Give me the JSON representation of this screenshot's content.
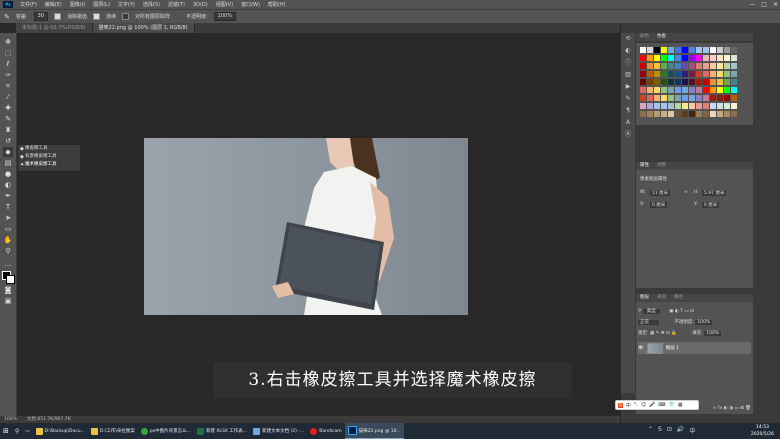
{
  "menu": {
    "app_logo": "Ps",
    "items": [
      "文件(F)",
      "编辑(E)",
      "图像(I)",
      "图层(L)",
      "文字(Y)",
      "选择(S)",
      "滤镜(T)",
      "3D(D)",
      "视图(V)",
      "窗口(W)",
      "帮助(H)"
    ],
    "min": "—",
    "max": "□",
    "close": "✕"
  },
  "options": {
    "tolerance_label": "容差:",
    "tolerance_value": "30",
    "antialias_label": "消除锯齿",
    "contiguous_label": "连续",
    "all_layers_label": "对所有图层取样",
    "opacity_label": "不透明度:",
    "opacity_value": "100%"
  },
  "tabs": [
    "未标题-1 @ 66.7%(RGB/8)",
    "猫咪22.png @ 100% (图层 1, RGB/8)"
  ],
  "flyout": {
    "items": [
      "橡皮擦工具",
      "背景橡皮擦工具",
      "魔术橡皮擦工具"
    ],
    "shortcut": "E"
  },
  "caption": "3.右击橡皮擦工具并选择魔术橡皮擦",
  "status": {
    "zoom": "100%",
    "doc": "文档:851.7K/907.7K"
  },
  "panels": {
    "color_tabs": [
      "颜色",
      "色板"
    ],
    "props_tabs": [
      "属性",
      "调整"
    ],
    "props_title": "像素图层属性",
    "w_label": "W:",
    "w_value": "11 厘米",
    "h_label": "H:",
    "h_value": "5.97 厘米",
    "x_label": "X:",
    "x_value": "0 厘米",
    "y_label": "Y:",
    "y_value": "0 厘米",
    "layers_tabs": [
      "图层",
      "通道",
      "路径"
    ],
    "kind_label": "类型",
    "blend_mode": "正常",
    "opacity_label": "不透明度:",
    "opacity_value": "100%",
    "lock_label": "锁定:",
    "fill_label": "填充:",
    "fill_value": "100%",
    "layer_name": "图层 1"
  },
  "taskbar": {
    "items": [
      "D:\\Backup\\Docu...",
      "D:\\工作\\朵拉图案",
      "ps中图片背景怎么...",
      "新建 XLSX 工作表...",
      "新建文本文档 (2) -...",
      "Bandicam",
      "猫咪22.png @ 10..."
    ],
    "time": "14:53",
    "date": "2020/5/26"
  },
  "ime_label": "中"
}
